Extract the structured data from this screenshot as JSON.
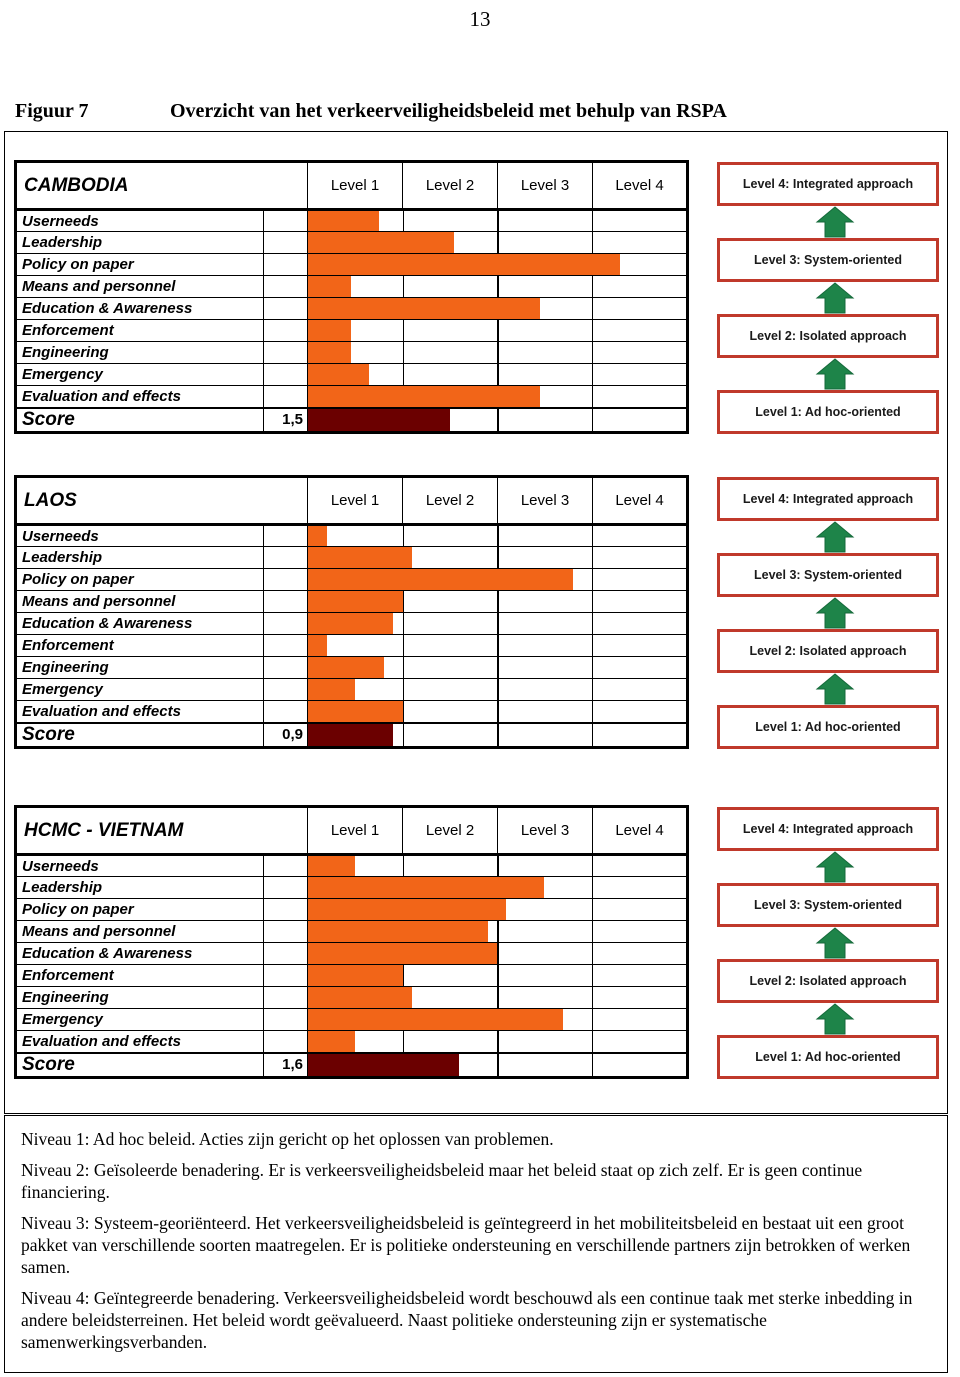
{
  "page": {
    "number": "13"
  },
  "figure": {
    "label": "Figuur 7",
    "title": "Overzicht van het verkeerveiligheidsbeleid met behulp van RSPA"
  },
  "level_headers": [
    "Level 1",
    "Level 2",
    "Level 3",
    "Level 4"
  ],
  "aspect_labels": [
    "Userneeds",
    "Leadership",
    "Policy on paper",
    "Means and personnel",
    "Education & Awareness",
    "Enforcement",
    "Engineering",
    "Emergency",
    "Evaluation and effects"
  ],
  "score_row_label": "Score",
  "colors": {
    "bar_orange": "#F26518",
    "score_maroon": "#6B0000",
    "pyramid_border_red": "#C0392B",
    "pyramid_arrow_green": "#1E8449"
  },
  "pyramid": {
    "boxes": [
      "Level 4: Integrated approach",
      "Level 3: System-oriented",
      "Level 2: Isolated approach",
      "Level 1: Ad hoc-oriented"
    ]
  },
  "chart_data": [
    {
      "type": "bar",
      "title": "CAMBODIA",
      "orientation": "horizontal",
      "categories": [
        "Userneeds",
        "Leadership",
        "Policy on paper",
        "Means and personnel",
        "Education & Awareness",
        "Enforcement",
        "Engineering",
        "Emergency",
        "Evaluation and effects"
      ],
      "values": [
        0.75,
        1.55,
        3.3,
        0.45,
        2.45,
        0.45,
        0.45,
        0.65,
        2.45
      ],
      "score": 1.5,
      "score_label": "1,5",
      "xlabel": "",
      "ylabel": "",
      "xlim": [
        0,
        4
      ],
      "xtick_labels": [
        "Level 1",
        "Level 2",
        "Level 3",
        "Level 4"
      ],
      "grid": true
    },
    {
      "type": "bar",
      "title": "LAOS",
      "orientation": "horizontal",
      "categories": [
        "Userneeds",
        "Leadership",
        "Policy on paper",
        "Means and personnel",
        "Education & Awareness",
        "Enforcement",
        "Engineering",
        "Emergency",
        "Evaluation and effects"
      ],
      "values": [
        0.2,
        1.1,
        2.8,
        1.0,
        0.9,
        0.2,
        0.8,
        0.5,
        1.0
      ],
      "score": 0.9,
      "score_label": "0,9",
      "xlabel": "",
      "ylabel": "",
      "xlim": [
        0,
        4
      ],
      "xtick_labels": [
        "Level 1",
        "Level 2",
        "Level 3",
        "Level 4"
      ],
      "grid": true
    },
    {
      "type": "bar",
      "title": "HCMC - VIETNAM",
      "orientation": "horizontal",
      "categories": [
        "Userneeds",
        "Leadership",
        "Policy on paper",
        "Means and personnel",
        "Education & Awareness",
        "Enforcement",
        "Engineering",
        "Emergency",
        "Evaluation and effects"
      ],
      "values": [
        0.5,
        2.5,
        2.1,
        1.9,
        2.0,
        1.0,
        1.1,
        2.7,
        0.5
      ],
      "score": 1.6,
      "score_label": "1,6",
      "xlabel": "",
      "ylabel": "",
      "xlim": [
        0,
        4
      ],
      "xtick_labels": [
        "Level 1",
        "Level 2",
        "Level 3",
        "Level 4"
      ],
      "grid": true
    }
  ],
  "explanation": {
    "paragraphs": [
      "Niveau 1: Ad hoc beleid. Acties zijn gericht op het oplossen van problemen.",
      "Niveau 2: Geïsoleerde benadering. Er is verkeersveiligheidsbeleid maar het beleid staat op zich zelf. Er is geen continue financiering.",
      "Niveau 3: Systeem-georiënteerd. Het verkeersveiligheidsbeleid is geïntegreerd in het mobiliteitsbeleid en bestaat uit een groot pakket van verschillende soorten maatregelen. Er is politieke ondersteuning en verschillende partners zijn betrokken of werken samen.",
      "Niveau 4: Geïntegreerde benadering. Verkeersveiligheidsbeleid wordt beschouwd als een continue taak met sterke inbedding in andere beleidsterreinen. Het beleid wordt geëvalueerd. Naast politieke ondersteuning zijn er systematische samenwerkingsverbanden."
    ]
  }
}
